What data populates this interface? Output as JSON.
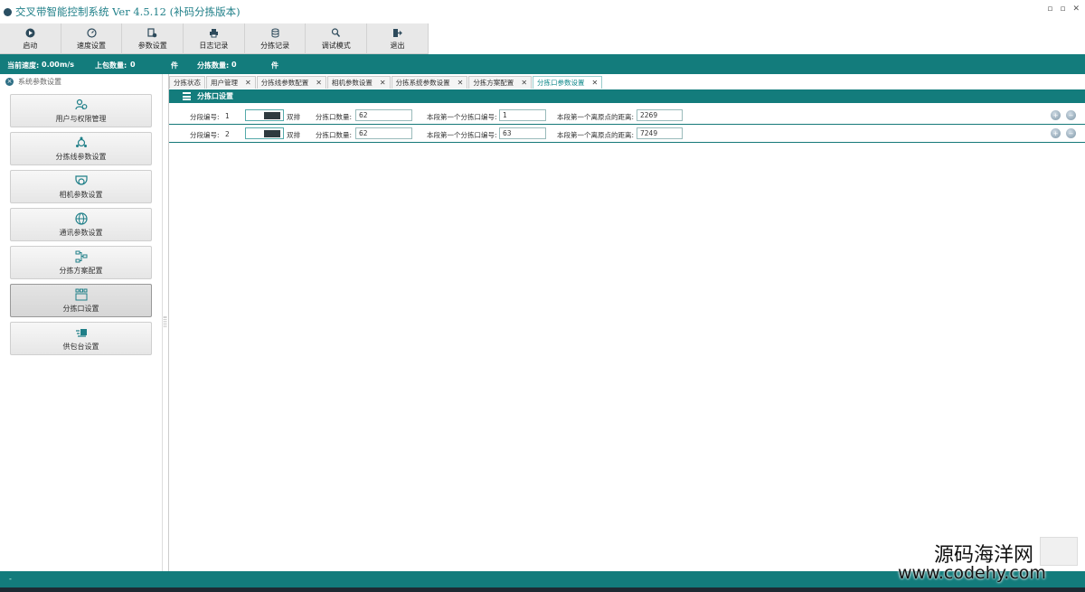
{
  "window": {
    "title": "交叉带智能控制系统 Ver 4.5.12 (补码分拣版本)",
    "controls": [
      "▫",
      "▫",
      "✕"
    ]
  },
  "toolbar": {
    "buttons": [
      {
        "label": "启动",
        "icon": "play-icon"
      },
      {
        "label": "速度设置",
        "icon": "speedometer-icon"
      },
      {
        "label": "参数设置",
        "icon": "params-icon"
      },
      {
        "label": "日志记录",
        "icon": "printer-icon"
      },
      {
        "label": "分拣记录",
        "icon": "database-icon"
      },
      {
        "label": "调试模式",
        "icon": "debug-icon"
      },
      {
        "label": "退出",
        "icon": "exit-icon"
      }
    ]
  },
  "statusbar": {
    "speed_label": "当前速度:",
    "speed_value": "0.00",
    "speed_unit": "m/s",
    "upload_label": "上包数量:",
    "upload_value": "0",
    "upload_unit": "件",
    "sort_label": "分拣数量:",
    "sort_value": "0",
    "sort_unit": "件"
  },
  "sidebar": {
    "header": "系统参数设置",
    "items": [
      {
        "label": "用户与权限管理",
        "icon": "users-icon"
      },
      {
        "label": "分拣线参数设置",
        "icon": "network-icon"
      },
      {
        "label": "相机参数设置",
        "icon": "camera-icon"
      },
      {
        "label": "通讯参数设置",
        "icon": "globe-icon"
      },
      {
        "label": "分拣方案配置",
        "icon": "flowchart-icon"
      },
      {
        "label": "分拣口设置",
        "icon": "grid-icon"
      },
      {
        "label": "供包台设置",
        "icon": "package-icon"
      }
    ],
    "active_index": 5
  },
  "tabs": [
    {
      "label": "分拣状态",
      "closable": false
    },
    {
      "label": "用户管理",
      "closable": true
    },
    {
      "label": "分拣线参数配置",
      "closable": true
    },
    {
      "label": "相机参数设置",
      "closable": true
    },
    {
      "label": "分拣系统参数设置",
      "closable": true
    },
    {
      "label": "分拣方案配置",
      "closable": true
    },
    {
      "label": "分拣口参数设置",
      "closable": true
    }
  ],
  "active_tab": 6,
  "section": {
    "title": "分拣口设置"
  },
  "rows": [
    {
      "seg_label": "分段编号:",
      "seg_value": "1",
      "color_label": "双排",
      "count_label": "分拣口数量:",
      "count_value": "62",
      "first_label": "本段第一个分拣口编号:",
      "first_value": "1",
      "dist_label": "本段第一个离原点的距离:",
      "dist_value": "2269"
    },
    {
      "seg_label": "分段编号:",
      "seg_value": "2",
      "color_label": "双排",
      "count_label": "分拣口数量:",
      "count_value": "62",
      "first_label": "本段第一个分拣口编号:",
      "first_value": "63",
      "dist_label": "本段第一个离原点的距离:",
      "dist_value": "7249"
    }
  ],
  "watermark": {
    "line1": "源码海洋网",
    "line2": "www.codehy.com"
  },
  "colors": {
    "accent": "#137c7c",
    "tab_active": "#138a8c"
  }
}
